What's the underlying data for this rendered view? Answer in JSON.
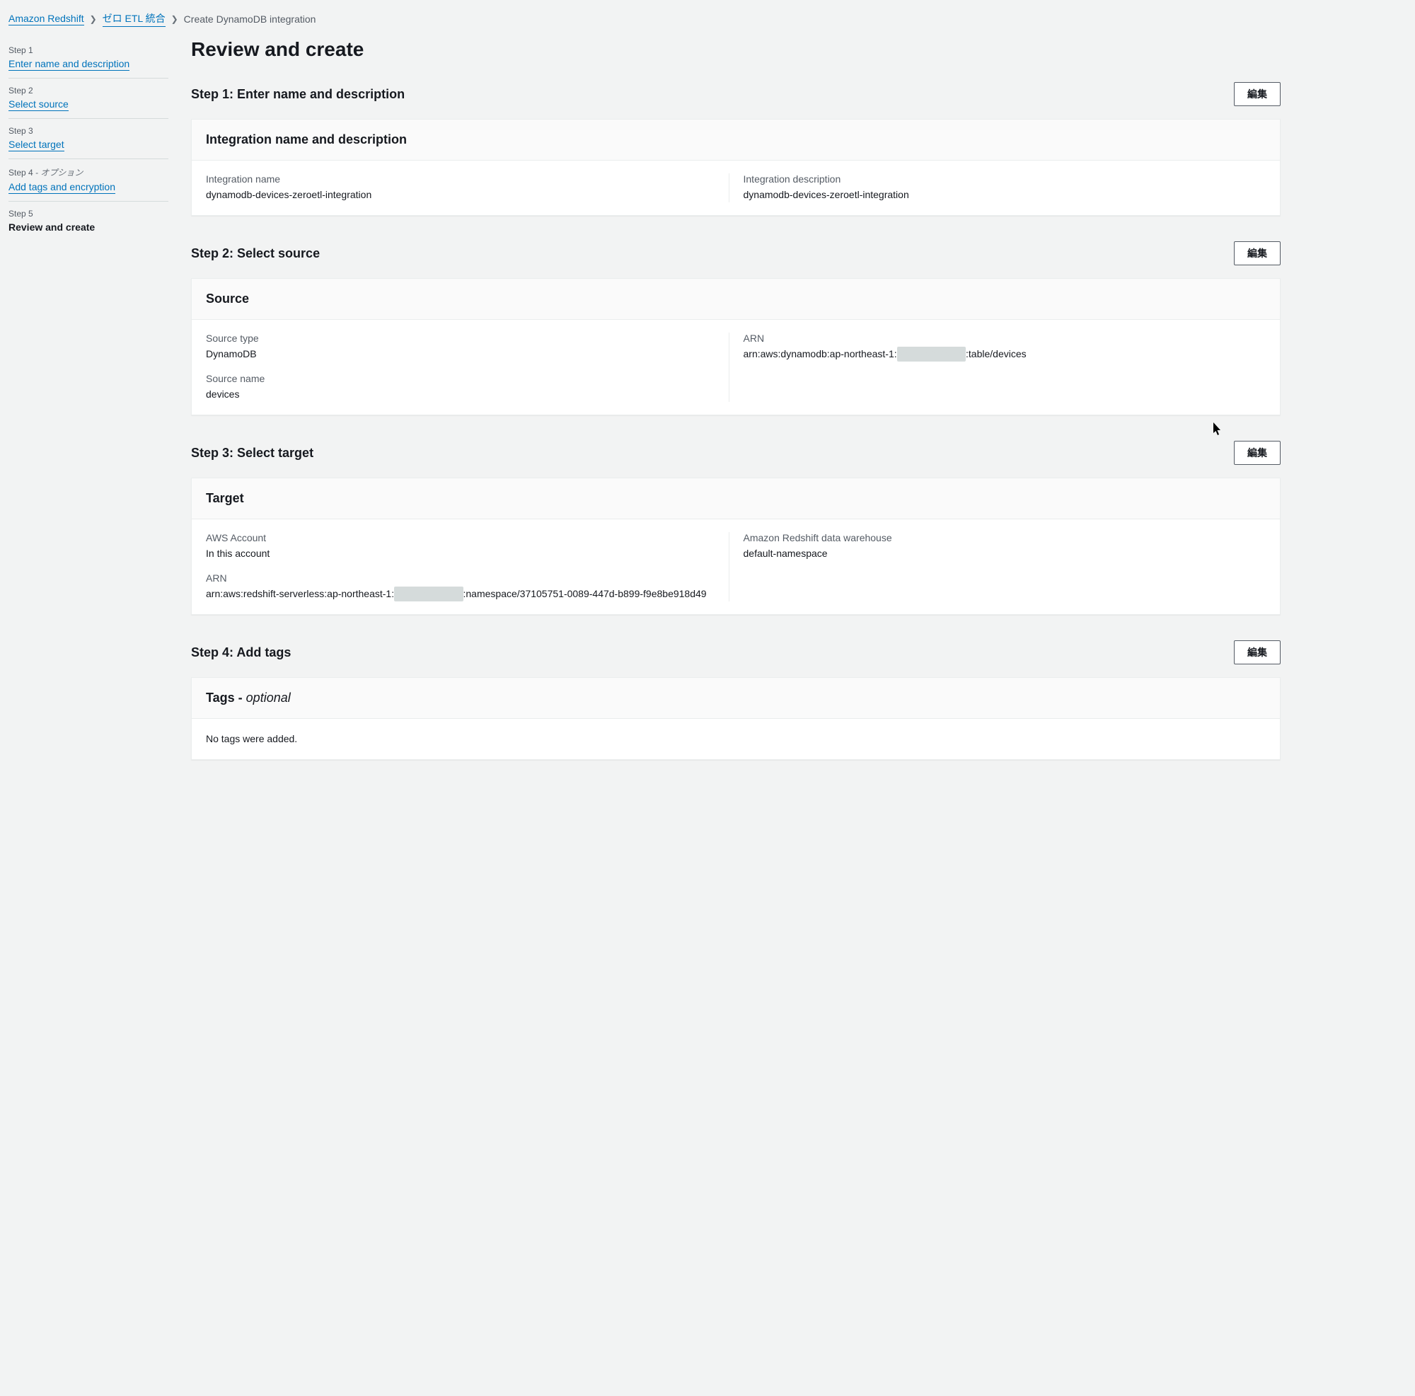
{
  "breadcrumb": {
    "root": "Amazon Redshift",
    "mid": "ゼロ ETL 統合",
    "current": "Create DynamoDB integration"
  },
  "sidebar": {
    "steps": [
      {
        "label": "Step 1",
        "option": "",
        "title": "Enter name and description",
        "link": true
      },
      {
        "label": "Step 2",
        "option": "",
        "title": "Select source",
        "link": true
      },
      {
        "label": "Step 3",
        "option": "",
        "title": "Select target",
        "link": true
      },
      {
        "label": "Step 4",
        "option": " - オプション",
        "title": "Add tags and encryption",
        "link": true
      },
      {
        "label": "Step 5",
        "option": "",
        "title": "Review and create",
        "link": false
      }
    ]
  },
  "page": {
    "title": "Review and create"
  },
  "buttons": {
    "edit": "編集"
  },
  "sections": {
    "step1": {
      "heading": "Step 1: Enter name and description",
      "panel_title": "Integration name and description",
      "name_label": "Integration name",
      "name_value": "dynamodb-devices-zeroetl-integration",
      "desc_label": "Integration description",
      "desc_value": "dynamodb-devices-zeroetl-integration"
    },
    "step2": {
      "heading": "Step 2: Select source",
      "panel_title": "Source",
      "type_label": "Source type",
      "type_value": "DynamoDB",
      "name_label": "Source name",
      "name_value": "devices",
      "arn_label": "ARN",
      "arn_prefix": "arn:aws:dynamodb:ap-northeast-1:",
      "arn_account_redacted": "XXXXXXXXXX",
      "arn_suffix": ":table/devices"
    },
    "step3": {
      "heading": "Step 3: Select target",
      "panel_title": "Target",
      "account_label": "AWS Account",
      "account_value": "In this account",
      "arn_label": "ARN",
      "arn_prefix": "arn:aws:redshift-serverless:ap-northeast-1:",
      "arn_account_redacted": "XXXXXXXXXX",
      "arn_suffix": ":namespace/37105751-0089-447d-b899-f9e8be918d49",
      "dw_label": "Amazon Redshift data warehouse",
      "dw_value": "default-namespace"
    },
    "step4": {
      "heading": "Step 4: Add tags",
      "panel_title_prefix": "Tags - ",
      "panel_title_optional": "optional",
      "empty_text": "No tags were added."
    }
  }
}
